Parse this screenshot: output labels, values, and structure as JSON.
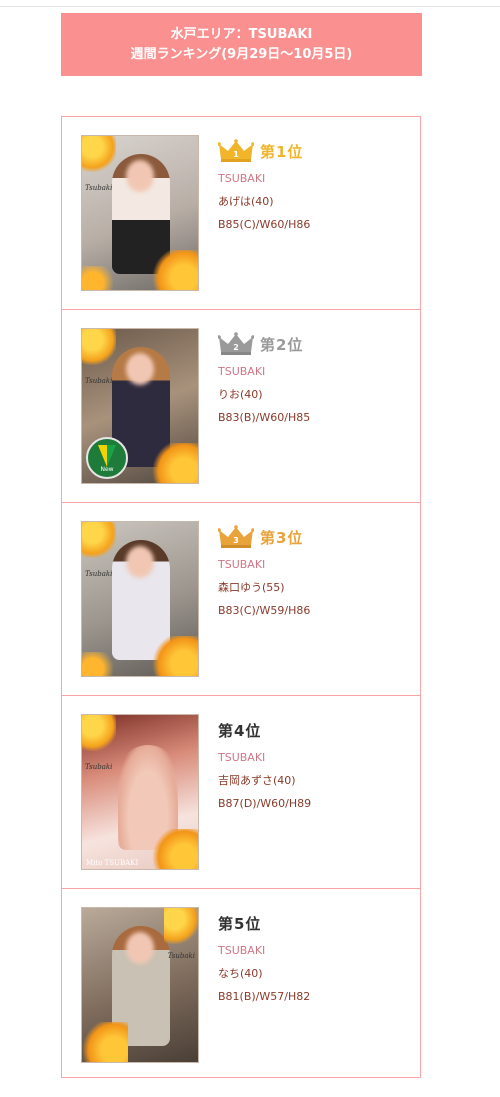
{
  "header": {
    "line1": "水戸エリア：TSUBAKI",
    "line2": "週間ランキング(9月29日〜10月5日)"
  },
  "colors": {
    "header_bg": "#fb9090",
    "border": "#f8a5a5",
    "gold": "#f0b52a",
    "silver": "#9a9a9a",
    "bronze": "#e8a33a",
    "shop_text": "#d07686",
    "detail_text": "#8a3a2a"
  },
  "ranking": [
    {
      "rank_label": "第1位",
      "crown": "gold-crown-icon",
      "crown_number": "1",
      "shop": "TSUBAKI",
      "name": "あげは(40)",
      "size": "B85(C)/W60/H86",
      "watermark": "Tsubaki"
    },
    {
      "rank_label": "第2位",
      "crown": "silver-crown-icon",
      "crown_number": "2",
      "shop": "TSUBAKI",
      "name": "りお(40)",
      "size": "B83(B)/W60/H85",
      "watermark": "Tsubaki",
      "badge": "new",
      "badge_text": "New"
    },
    {
      "rank_label": "第3位",
      "crown": "bronze-crown-icon",
      "crown_number": "3",
      "shop": "TSUBAKI",
      "name": "森口ゆう(55)",
      "size": "B83(C)/W59/H86",
      "watermark": "Tsubaki"
    },
    {
      "rank_label": "第4位",
      "crown": "",
      "shop": "TSUBAKI",
      "name": "吉岡あずさ(40)",
      "size": "B87(D)/W60/H89",
      "watermark": "Tsubaki",
      "photo_caption": "Mito TSUBAKI"
    },
    {
      "rank_label": "第5位",
      "crown": "",
      "shop": "TSUBAKI",
      "name": "なち(40)",
      "size": "B81(B)/W57/H82",
      "watermark": "Tsubaki"
    }
  ]
}
